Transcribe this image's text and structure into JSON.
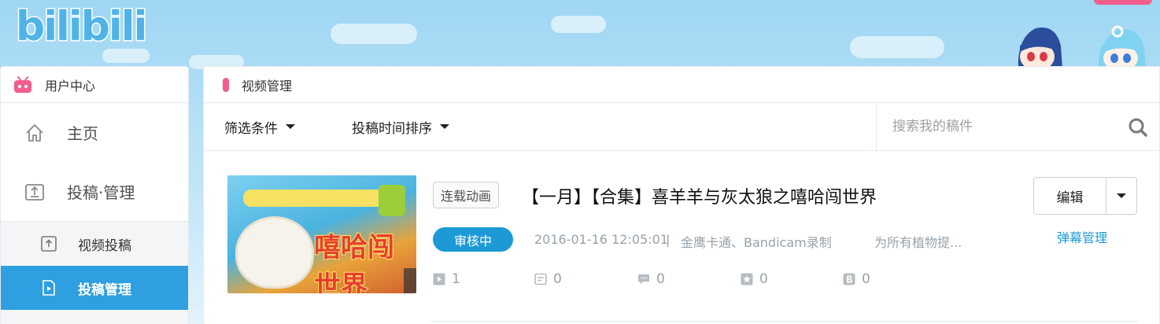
{
  "logo": "bilibili",
  "sidebar": {
    "header": "用户中心",
    "items": [
      {
        "label": "主页",
        "icon": "home-icon"
      },
      {
        "label": "投稿·管理",
        "icon": "upload-box-icon"
      }
    ],
    "subitems": [
      {
        "label": "视频投稿",
        "icon": "upload-icon",
        "active": false
      },
      {
        "label": "投稿管理",
        "icon": "video-manage-icon",
        "active": true
      }
    ]
  },
  "main": {
    "header": "视频管理",
    "filters": {
      "filter_label": "筛选条件",
      "sort_label": "投稿时间排序"
    },
    "search": {
      "placeholder": "搜索我的稿件"
    },
    "video": {
      "tag": "连载动画",
      "title": "【一月】【合集】喜羊羊与灰太狼之嘻哈闯世界",
      "status": "审核中",
      "date": "2016-01-16 12:05:01",
      "separator": "|",
      "tools": "金鹰卡通、Bandicam录制",
      "description": "为所有植物提...",
      "thumbnail_text": "嘻哈闯世界",
      "stats": [
        {
          "icon": "play-icon",
          "value": "1"
        },
        {
          "icon": "comment-icon",
          "value": "0"
        },
        {
          "icon": "danmaku-icon",
          "value": "0"
        },
        {
          "icon": "star-icon",
          "value": "0"
        },
        {
          "icon": "coin-icon",
          "value": "0"
        }
      ],
      "edit_label": "编辑",
      "danmaku_label": "弹幕管理"
    }
  },
  "colors": {
    "accent_blue": "#1d9ad6",
    "pink": "#f25d8e",
    "active_nav": "#2e9fe0"
  }
}
